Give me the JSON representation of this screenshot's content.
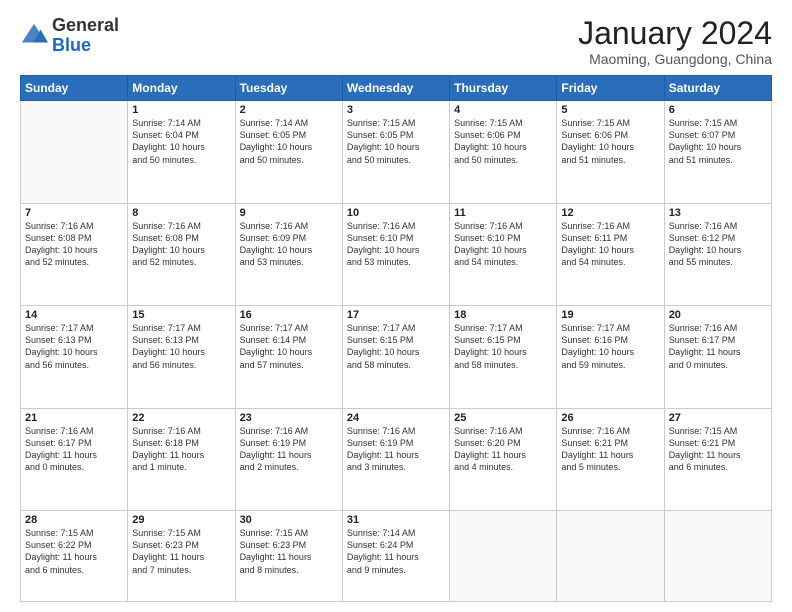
{
  "header": {
    "logo_general": "General",
    "logo_blue": "Blue",
    "month_title": "January 2024",
    "subtitle": "Maoming, Guangdong, China"
  },
  "days_of_week": [
    "Sunday",
    "Monday",
    "Tuesday",
    "Wednesday",
    "Thursday",
    "Friday",
    "Saturday"
  ],
  "weeks": [
    [
      {
        "day": "",
        "info": ""
      },
      {
        "day": "1",
        "info": "Sunrise: 7:14 AM\nSunset: 6:04 PM\nDaylight: 10 hours\nand 50 minutes."
      },
      {
        "day": "2",
        "info": "Sunrise: 7:14 AM\nSunset: 6:05 PM\nDaylight: 10 hours\nand 50 minutes."
      },
      {
        "day": "3",
        "info": "Sunrise: 7:15 AM\nSunset: 6:05 PM\nDaylight: 10 hours\nand 50 minutes."
      },
      {
        "day": "4",
        "info": "Sunrise: 7:15 AM\nSunset: 6:06 PM\nDaylight: 10 hours\nand 50 minutes."
      },
      {
        "day": "5",
        "info": "Sunrise: 7:15 AM\nSunset: 6:06 PM\nDaylight: 10 hours\nand 51 minutes."
      },
      {
        "day": "6",
        "info": "Sunrise: 7:15 AM\nSunset: 6:07 PM\nDaylight: 10 hours\nand 51 minutes."
      }
    ],
    [
      {
        "day": "7",
        "info": "Sunrise: 7:16 AM\nSunset: 6:08 PM\nDaylight: 10 hours\nand 52 minutes."
      },
      {
        "day": "8",
        "info": "Sunrise: 7:16 AM\nSunset: 6:08 PM\nDaylight: 10 hours\nand 52 minutes."
      },
      {
        "day": "9",
        "info": "Sunrise: 7:16 AM\nSunset: 6:09 PM\nDaylight: 10 hours\nand 53 minutes."
      },
      {
        "day": "10",
        "info": "Sunrise: 7:16 AM\nSunset: 6:10 PM\nDaylight: 10 hours\nand 53 minutes."
      },
      {
        "day": "11",
        "info": "Sunrise: 7:16 AM\nSunset: 6:10 PM\nDaylight: 10 hours\nand 54 minutes."
      },
      {
        "day": "12",
        "info": "Sunrise: 7:16 AM\nSunset: 6:11 PM\nDaylight: 10 hours\nand 54 minutes."
      },
      {
        "day": "13",
        "info": "Sunrise: 7:16 AM\nSunset: 6:12 PM\nDaylight: 10 hours\nand 55 minutes."
      }
    ],
    [
      {
        "day": "14",
        "info": "Sunrise: 7:17 AM\nSunset: 6:13 PM\nDaylight: 10 hours\nand 56 minutes."
      },
      {
        "day": "15",
        "info": "Sunrise: 7:17 AM\nSunset: 6:13 PM\nDaylight: 10 hours\nand 56 minutes."
      },
      {
        "day": "16",
        "info": "Sunrise: 7:17 AM\nSunset: 6:14 PM\nDaylight: 10 hours\nand 57 minutes."
      },
      {
        "day": "17",
        "info": "Sunrise: 7:17 AM\nSunset: 6:15 PM\nDaylight: 10 hours\nand 58 minutes."
      },
      {
        "day": "18",
        "info": "Sunrise: 7:17 AM\nSunset: 6:15 PM\nDaylight: 10 hours\nand 58 minutes."
      },
      {
        "day": "19",
        "info": "Sunrise: 7:17 AM\nSunset: 6:16 PM\nDaylight: 10 hours\nand 59 minutes."
      },
      {
        "day": "20",
        "info": "Sunrise: 7:16 AM\nSunset: 6:17 PM\nDaylight: 11 hours\nand 0 minutes."
      }
    ],
    [
      {
        "day": "21",
        "info": "Sunrise: 7:16 AM\nSunset: 6:17 PM\nDaylight: 11 hours\nand 0 minutes."
      },
      {
        "day": "22",
        "info": "Sunrise: 7:16 AM\nSunset: 6:18 PM\nDaylight: 11 hours\nand 1 minute."
      },
      {
        "day": "23",
        "info": "Sunrise: 7:16 AM\nSunset: 6:19 PM\nDaylight: 11 hours\nand 2 minutes."
      },
      {
        "day": "24",
        "info": "Sunrise: 7:16 AM\nSunset: 6:19 PM\nDaylight: 11 hours\nand 3 minutes."
      },
      {
        "day": "25",
        "info": "Sunrise: 7:16 AM\nSunset: 6:20 PM\nDaylight: 11 hours\nand 4 minutes."
      },
      {
        "day": "26",
        "info": "Sunrise: 7:16 AM\nSunset: 6:21 PM\nDaylight: 11 hours\nand 5 minutes."
      },
      {
        "day": "27",
        "info": "Sunrise: 7:15 AM\nSunset: 6:21 PM\nDaylight: 11 hours\nand 6 minutes."
      }
    ],
    [
      {
        "day": "28",
        "info": "Sunrise: 7:15 AM\nSunset: 6:22 PM\nDaylight: 11 hours\nand 6 minutes."
      },
      {
        "day": "29",
        "info": "Sunrise: 7:15 AM\nSunset: 6:23 PM\nDaylight: 11 hours\nand 7 minutes."
      },
      {
        "day": "30",
        "info": "Sunrise: 7:15 AM\nSunset: 6:23 PM\nDaylight: 11 hours\nand 8 minutes."
      },
      {
        "day": "31",
        "info": "Sunrise: 7:14 AM\nSunset: 6:24 PM\nDaylight: 11 hours\nand 9 minutes."
      },
      {
        "day": "",
        "info": ""
      },
      {
        "day": "",
        "info": ""
      },
      {
        "day": "",
        "info": ""
      }
    ]
  ]
}
